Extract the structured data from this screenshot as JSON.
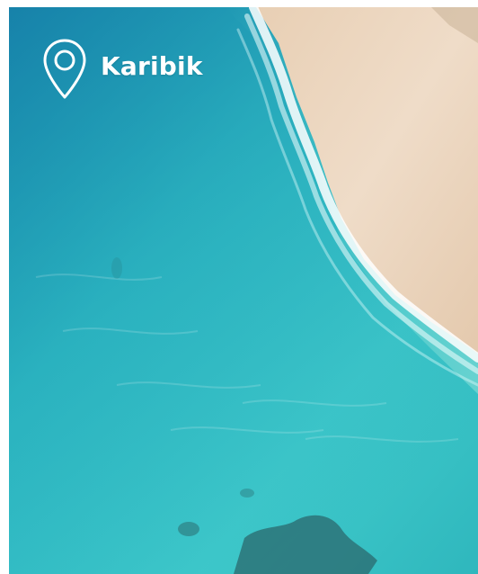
{
  "destination": {
    "name": "Karibik",
    "icon": "location-pin-icon"
  },
  "colors": {
    "label_text": "#ffffff",
    "water": "#2cc0c4",
    "sand": "#e9d6c0"
  }
}
